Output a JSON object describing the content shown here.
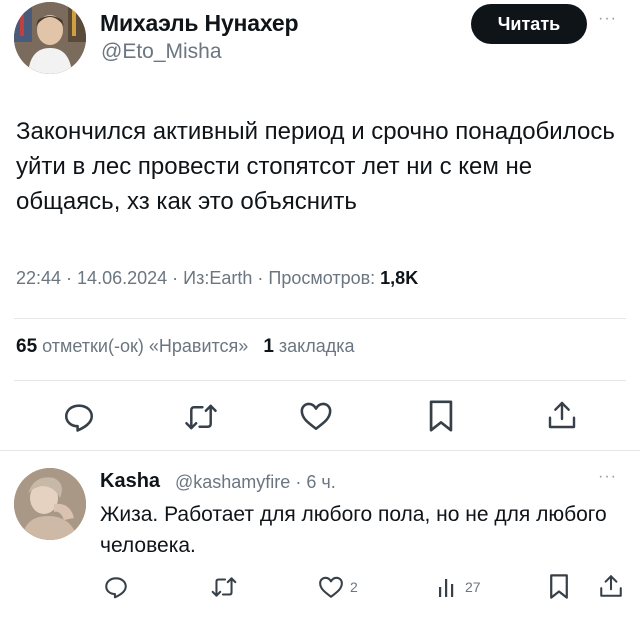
{
  "tweet": {
    "author_name": "Михаэль Нунахер",
    "author_handle": "@Eto_Misha",
    "read_label": "Читать",
    "more": "···",
    "text": "Закончился активный период и срочно понадобилось уйти в лес провести стопятсот лет ни с кем не общаясь, хз как это объяснить",
    "time": "22:44",
    "date": "14.06.2024",
    "source_prefix": "Из:",
    "source": "Earth",
    "views_label": "Просмотров:",
    "views_count": "1,8K",
    "sep": " · ",
    "likes_count": "65",
    "likes_label": "отметки(-ок) «Нравится»",
    "bookmarks_count": "1",
    "bookmarks_label": "закладка"
  },
  "actions": [
    {
      "icon": "reply-icon"
    },
    {
      "icon": "retweet-icon"
    },
    {
      "icon": "like-icon"
    },
    {
      "icon": "bookmark-icon"
    },
    {
      "icon": "share-icon"
    }
  ],
  "reply": {
    "author_name": "Kasha",
    "author_handle": "@kashamyfire",
    "time": "6 ч.",
    "more": "···",
    "text": "Жиза. Работает для любого пола, но не для любого человека.",
    "likes": "2",
    "views": "27",
    "icons": [
      "reply-icon",
      "retweet-icon",
      "like-icon",
      "views-icon",
      "bookmark-icon",
      "share-icon"
    ]
  },
  "colors": {
    "text": "#0f1419",
    "secondary": "#6b7680",
    "divider": "#e3e7ea",
    "button": "#0f1419"
  }
}
